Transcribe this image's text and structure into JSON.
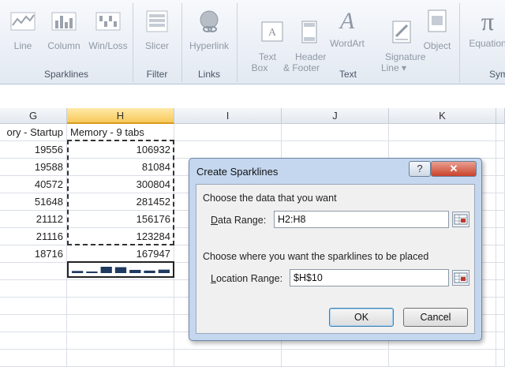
{
  "ribbon": {
    "groups": [
      {
        "label": "Sparklines",
        "buttons": [
          "Line",
          "Column",
          "Win/Loss"
        ]
      },
      {
        "label": "Filter",
        "buttons": [
          "Slicer"
        ]
      },
      {
        "label": "Links",
        "buttons": [
          "Hyperlink"
        ]
      },
      {
        "label": "Text",
        "buttons": [
          "Text\nBox",
          "Header\n& Footer",
          "WordArt",
          "Signature\nLine ▾",
          "Object"
        ]
      },
      {
        "label": "Sym",
        "buttons": [
          "Equation"
        ]
      }
    ],
    "equation_symbol": "π",
    "wordart_symbol": "A"
  },
  "sheet": {
    "columns": [
      "G",
      "H",
      "I",
      "J",
      "K"
    ],
    "header_row": {
      "G": "ory - Startup",
      "H": "Memory - 9 tabs"
    },
    "rows": [
      {
        "G": "19556",
        "H": "106932"
      },
      {
        "G": "19588",
        "H": "81084"
      },
      {
        "G": "40572",
        "H": "300804"
      },
      {
        "G": "51648",
        "H": "281452"
      },
      {
        "G": "21112",
        "H": "156176"
      },
      {
        "G": "21116",
        "H": "123284"
      },
      {
        "G": "18716",
        "H": "167947"
      }
    ],
    "sparkline_values": [
      106932,
      81084,
      300804,
      281452,
      156176,
      123284,
      167947
    ],
    "sparkline_color": "#1f3a60"
  },
  "dialog": {
    "title": "Create Sparklines",
    "help_label": "?",
    "close_label": "✕",
    "section1": "Choose the data that you want",
    "data_range_label": "Data Range:",
    "data_range_value": "H2:H8",
    "section2": "Choose where you want the sparklines to be placed",
    "location_range_label": "Location Range:",
    "location_range_value": "$H$10",
    "ok_label": "OK",
    "cancel_label": "Cancel"
  }
}
